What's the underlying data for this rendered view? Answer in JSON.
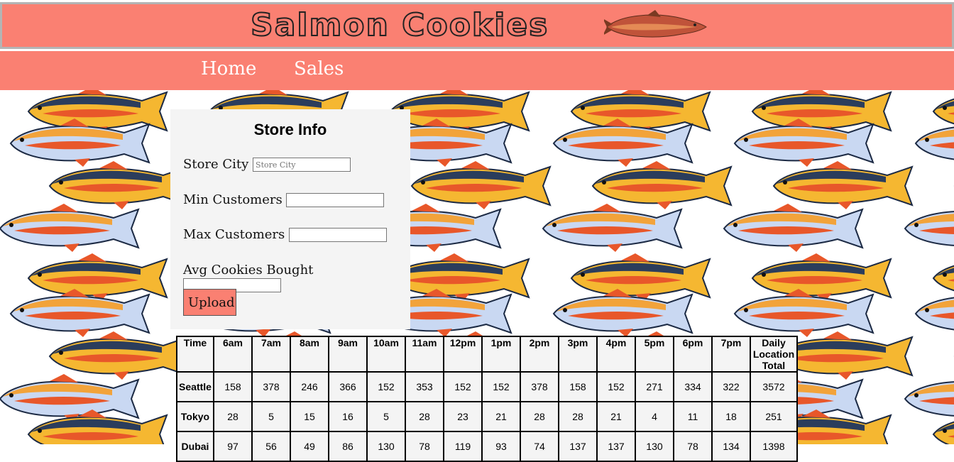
{
  "header": {
    "logo_text": "Salmon Cookies"
  },
  "nav": {
    "items": [
      {
        "label": "Home"
      },
      {
        "label": "Sales"
      }
    ]
  },
  "form": {
    "title": "Store Info",
    "fields": [
      {
        "label": "Store City",
        "placeholder": "Store City",
        "value": ""
      },
      {
        "label": "Min Customers",
        "placeholder": "",
        "value": ""
      },
      {
        "label": "Max Customers",
        "placeholder": "",
        "value": ""
      },
      {
        "label": "Avg Cookies Bought",
        "placeholder": "",
        "value": ""
      }
    ],
    "submit_label": "Upload"
  },
  "table": {
    "headers": [
      "Time",
      "6am",
      "7am",
      "8am",
      "9am",
      "10am",
      "11am",
      "12pm",
      "1pm",
      "2pm",
      "3pm",
      "4pm",
      "5pm",
      "6pm",
      "7pm",
      "Daily Location Total"
    ],
    "rows": [
      {
        "location": "Seattle",
        "values": [
          "158",
          "378",
          "246",
          "366",
          "152",
          "353",
          "152",
          "152",
          "378",
          "158",
          "152",
          "271",
          "334",
          "322",
          "3572"
        ]
      },
      {
        "location": "Tokyo",
        "values": [
          "28",
          "5",
          "15",
          "16",
          "5",
          "28",
          "23",
          "21",
          "28",
          "28",
          "21",
          "4",
          "11",
          "18",
          "251"
        ]
      },
      {
        "location": "Dubai",
        "values": [
          "97",
          "56",
          "49",
          "86",
          "130",
          "78",
          "119",
          "93",
          "74",
          "137",
          "137",
          "130",
          "78",
          "134",
          "1398"
        ]
      }
    ]
  },
  "colors": {
    "accent": "#fa8072",
    "panel": "#f4f4f4"
  }
}
